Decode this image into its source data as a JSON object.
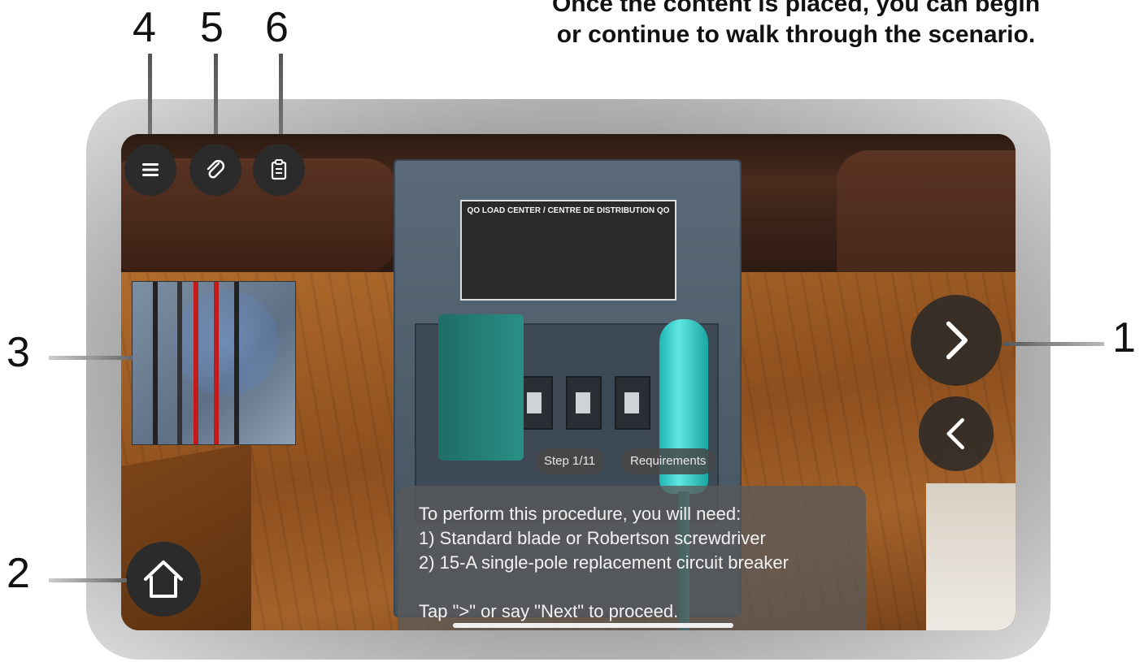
{
  "caption": {
    "line1": "Once the content is placed, you can begin",
    "line2": "or continue to walk through the scenario."
  },
  "callouts": {
    "n1": "1",
    "n2": "2",
    "n3": "3",
    "n4": "4",
    "n5": "5",
    "n6": "6"
  },
  "panel_label": {
    "title": "QO LOAD CENTER / CENTRE DE DISTRIBUTION QO"
  },
  "toolbar": {
    "menu_icon": "hamburger-menu-icon",
    "attach_icon": "paperclip-icon",
    "clipboard_icon": "clipboard-icon"
  },
  "step": {
    "step_label": "Step 1/11",
    "requirements_label": "Requirements"
  },
  "instructions": {
    "line1": "To perform this procedure, you will need:",
    "line2": "1) Standard blade or Robertson screwdriver",
    "line3": "2) 15-A single-pole replacement circuit breaker",
    "line4": "Tap \">\" or say \"Next\" to proceed."
  },
  "colors": {
    "button_bg": "#2b2b2b",
    "screwdriver": "#1db8b4",
    "breaker": "#2a8f86"
  }
}
